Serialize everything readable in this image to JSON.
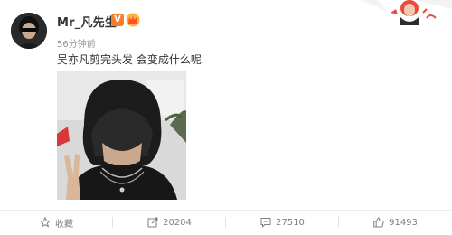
{
  "post": {
    "author": "Mr_凡先生",
    "vip_badge": "V",
    "timestamp": "56分钟前",
    "text": "吴亦凡剪完头发 会变成什么呢",
    "avatar_icon": "avatar-sunglasses",
    "crown_icon": "crown-icon",
    "photo_alt": "selfie-with-bangs"
  },
  "actions": {
    "favorite_label": "收藏",
    "repost_count": "20204",
    "comment_count": "27510",
    "like_count": "91493"
  },
  "colors": {
    "vip_orange": "#f77c2b",
    "text_dark": "#333333",
    "text_muted": "#939393",
    "footer_text": "#808080"
  }
}
